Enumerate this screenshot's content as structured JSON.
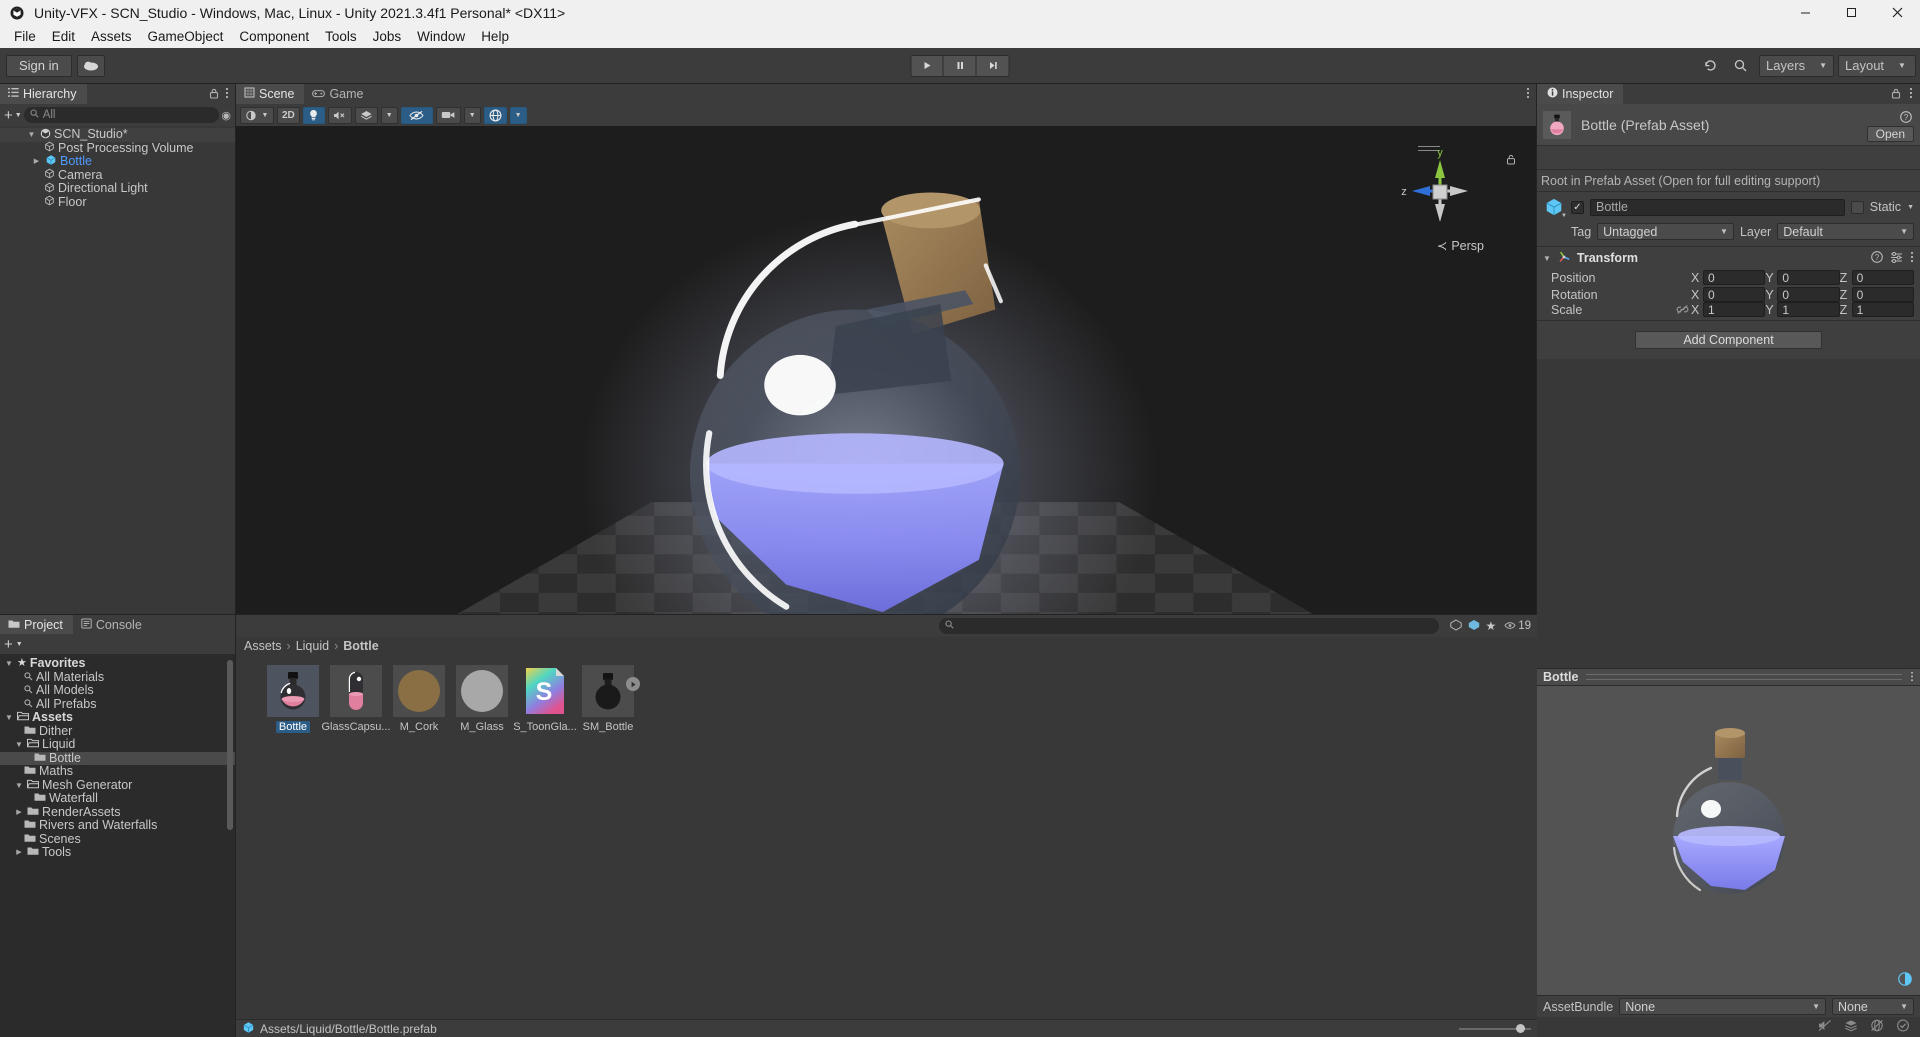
{
  "window": {
    "title": "Unity-VFX - SCN_Studio - Windows, Mac, Linux - Unity 2021.3.4f1 Personal* <DX11>",
    "app_icon": "unity-icon",
    "minimize": "─",
    "maximize": "☐",
    "close": "✕"
  },
  "menubar": {
    "items": [
      "File",
      "Edit",
      "Assets",
      "GameObject",
      "Component",
      "Tools",
      "Jobs",
      "Window",
      "Help"
    ]
  },
  "toolbar": {
    "sign_in": "Sign in",
    "cloud_icon": "cloud-icon",
    "play": "▶",
    "pause": "⏸",
    "step": "⏭",
    "history_icon": "undo-history-icon",
    "search_icon": "search-icon",
    "layers": "Layers",
    "layout": "Layout"
  },
  "hierarchy": {
    "tab": "Hierarchy",
    "tab_icon": "hierarchy-icon",
    "add_label": "+",
    "search_placeholder": "All",
    "items": [
      {
        "label": "SCN_Studio*",
        "depth": 0,
        "icon": "scene-icon",
        "twisty": "▼",
        "selected": false,
        "root": true
      },
      {
        "label": "Post Processing Volume",
        "depth": 1,
        "icon": "gameobject-icon",
        "twisty": "",
        "selected": false,
        "root": false
      },
      {
        "label": "Bottle",
        "depth": 1,
        "icon": "prefab-icon",
        "twisty": "▶",
        "selected": true,
        "root": false
      },
      {
        "label": "Camera",
        "depth": 1,
        "icon": "gameobject-icon",
        "twisty": "",
        "selected": false,
        "root": false
      },
      {
        "label": "Directional Light",
        "depth": 1,
        "icon": "gameobject-icon",
        "twisty": "",
        "selected": false,
        "root": false
      },
      {
        "label": "Floor",
        "depth": 1,
        "icon": "gameobject-icon",
        "twisty": "",
        "selected": false,
        "root": false
      }
    ]
  },
  "scene": {
    "tabs": [
      {
        "label": "Scene",
        "icon": "scene-tab-icon",
        "active": true
      },
      {
        "label": "Game",
        "icon": "game-tab-icon",
        "active": false
      }
    ],
    "toolbar": {
      "shading_icon": "shading-mode-icon",
      "twod_label": "2D",
      "lighting_icon": "light-bulb-icon",
      "audio_icon": "audio-mute-icon",
      "fx_icon": "effects-icon",
      "hidden_icon": "hidden-objects-icon",
      "camera_icon": "scene-camera-icon",
      "gizmos_icon": "gizmos-icon"
    },
    "gizmo": {
      "y_label": "y",
      "z_label": "z",
      "persp_label": "Persp",
      "persp_prefix": "≺"
    },
    "tools": [
      {
        "name": "hand-tool",
        "glyph": "✋",
        "active": false
      },
      {
        "name": "move-tool",
        "glyph": "✥",
        "active": false
      },
      {
        "name": "rotate-tool",
        "glyph": "↻",
        "active": true
      },
      {
        "name": "scale-tool",
        "glyph": "⧉",
        "active": false
      },
      {
        "name": "rect-tool",
        "glyph": "⌗",
        "active": false
      },
      {
        "name": "transform-tool",
        "glyph": "⬡",
        "active": false
      }
    ]
  },
  "project": {
    "tabs": [
      {
        "label": "Project",
        "icon": "folder-icon",
        "active": true
      },
      {
        "label": "Console",
        "icon": "console-icon",
        "active": false
      }
    ],
    "add_label": "+",
    "search_placeholder": "",
    "search_icon": "search-icon",
    "count_badge": "19",
    "breadcrumb": [
      "Assets",
      "Liquid",
      "Bottle"
    ],
    "breadcrumb_sep": "›",
    "tree": [
      {
        "label": "Favorites",
        "depth": 0,
        "twisty": "▼",
        "icon": "star-icon",
        "bold": true,
        "selected": false
      },
      {
        "label": "All Materials",
        "depth": 1,
        "twisty": "",
        "icon": "search-icon",
        "bold": false,
        "selected": false
      },
      {
        "label": "All Models",
        "depth": 1,
        "twisty": "",
        "icon": "search-icon",
        "bold": false,
        "selected": false
      },
      {
        "label": "All Prefabs",
        "depth": 1,
        "twisty": "",
        "icon": "search-icon",
        "bold": false,
        "selected": false
      },
      {
        "label": "Assets",
        "depth": 0,
        "twisty": "▼",
        "icon": "folder-open-icon",
        "bold": true,
        "selected": false
      },
      {
        "label": "Dither",
        "depth": 1,
        "twisty": "",
        "icon": "folder-icon",
        "bold": false,
        "selected": false
      },
      {
        "label": "Liquid",
        "depth": 1,
        "twisty": "▼",
        "icon": "folder-open-icon",
        "bold": false,
        "selected": false
      },
      {
        "label": "Bottle",
        "depth": 2,
        "twisty": "",
        "icon": "folder-icon",
        "bold": false,
        "selected": true
      },
      {
        "label": "Maths",
        "depth": 1,
        "twisty": "",
        "icon": "folder-icon",
        "bold": false,
        "selected": false
      },
      {
        "label": "Mesh Generator",
        "depth": 1,
        "twisty": "▼",
        "icon": "folder-open-icon",
        "bold": false,
        "selected": false
      },
      {
        "label": "Waterfall",
        "depth": 2,
        "twisty": "",
        "icon": "folder-icon",
        "bold": false,
        "selected": false
      },
      {
        "label": "RenderAssets",
        "depth": 1,
        "twisty": "▶",
        "icon": "folder-icon",
        "bold": false,
        "selected": false
      },
      {
        "label": "Rivers and Waterfalls",
        "depth": 1,
        "twisty": "",
        "icon": "folder-icon",
        "bold": false,
        "selected": false
      },
      {
        "label": "Scenes",
        "depth": 1,
        "twisty": "",
        "icon": "folder-icon",
        "bold": false,
        "selected": false
      },
      {
        "label": "Tools",
        "depth": 1,
        "twisty": "▶",
        "icon": "folder-icon",
        "bold": false,
        "selected": false
      }
    ],
    "assets": [
      {
        "label": "Bottle",
        "kind": "prefab-potion",
        "selected": true
      },
      {
        "label": "GlassCapsu...",
        "kind": "prefab-capsule",
        "selected": false
      },
      {
        "label": "M_Cork",
        "kind": "material-brown",
        "selected": false
      },
      {
        "label": "M_Glass",
        "kind": "material-grey",
        "selected": false
      },
      {
        "label": "S_ToonGla...",
        "kind": "shader",
        "shader_letter": "S",
        "selected": false
      },
      {
        "label": "SM_Bottle",
        "kind": "model",
        "selected": false
      }
    ],
    "status_path": "Assets/Liquid/Bottle/Bottle.prefab",
    "status_icon": "prefab-icon"
  },
  "inspector": {
    "tab": "Inspector",
    "tab_icon": "info-icon",
    "lock_icon": "lock-icon",
    "menu_icon": "kebab-icon",
    "help_icon": "help-icon",
    "asset_title": "Bottle (Prefab Asset)",
    "open_button": "Open",
    "prefab_note": "Root in Prefab Asset (Open for full editing support)",
    "gameobject": {
      "enabled": true,
      "name": "Bottle",
      "static_label": "Static",
      "static_checked": false,
      "tag_label": "Tag",
      "tag_value": "Untagged",
      "layer_label": "Layer",
      "layer_value": "Default"
    },
    "transform": {
      "title": "Transform",
      "icon": "transform-icon",
      "rows": [
        {
          "label": "Position",
          "x": "0",
          "y": "0",
          "z": "0",
          "link": false
        },
        {
          "label": "Rotation",
          "x": "0",
          "y": "0",
          "z": "0",
          "link": false
        },
        {
          "label": "Scale",
          "x": "1",
          "y": "1",
          "z": "1",
          "link": true
        }
      ],
      "axis_labels": [
        "X",
        "Y",
        "Z"
      ]
    },
    "add_component": "Add Component",
    "preview_title": "Bottle",
    "assetbundle_label": "AssetBundle",
    "assetbundle_value": "None",
    "assetbundle_variant": "None"
  },
  "colors": {
    "accent_blue": "#4f9bff",
    "selection_blue": "#2c5d87",
    "panel_bg": "#383838",
    "toolbar_bg": "#3c3c3c",
    "scene_bg": "#1d1d1d",
    "liquid_purple": "#8c8cf5",
    "cork_brown": "#9a7b52",
    "axis_y_green": "#8cc63f",
    "axis_z_blue": "#2f6fd8"
  }
}
